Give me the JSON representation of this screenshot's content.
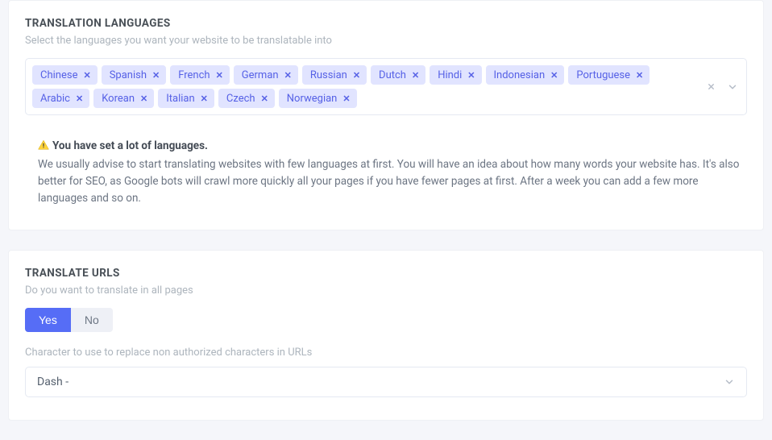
{
  "section1": {
    "title": "TRANSLATION LANGUAGES",
    "subtitle": "Select the languages you want your website to be translatable into"
  },
  "languages": [
    "Chinese",
    "Spanish",
    "French",
    "German",
    "Russian",
    "Dutch",
    "Hindi",
    "Indonesian",
    "Portuguese",
    "Arabic",
    "Korean",
    "Italian",
    "Czech",
    "Norwegian"
  ],
  "warning": {
    "head": "You have set a lot of languages.",
    "body": "We usually advise to start translating websites with few languages at first. You will have an idea about how many words your website has. It's also better for SEO, as Google bots will crawl more quickly all your pages if you have fewer pages at first. After a week you can add a few more languages and so on."
  },
  "section2": {
    "title": "TRANSLATE URLS",
    "subtitle": "Do you want to translate in all pages",
    "char_label": "Character to use to replace non authorized characters in URLs"
  },
  "toggle": {
    "yes": "Yes",
    "no": "No"
  },
  "url_char_select": {
    "value": "Dash -"
  }
}
